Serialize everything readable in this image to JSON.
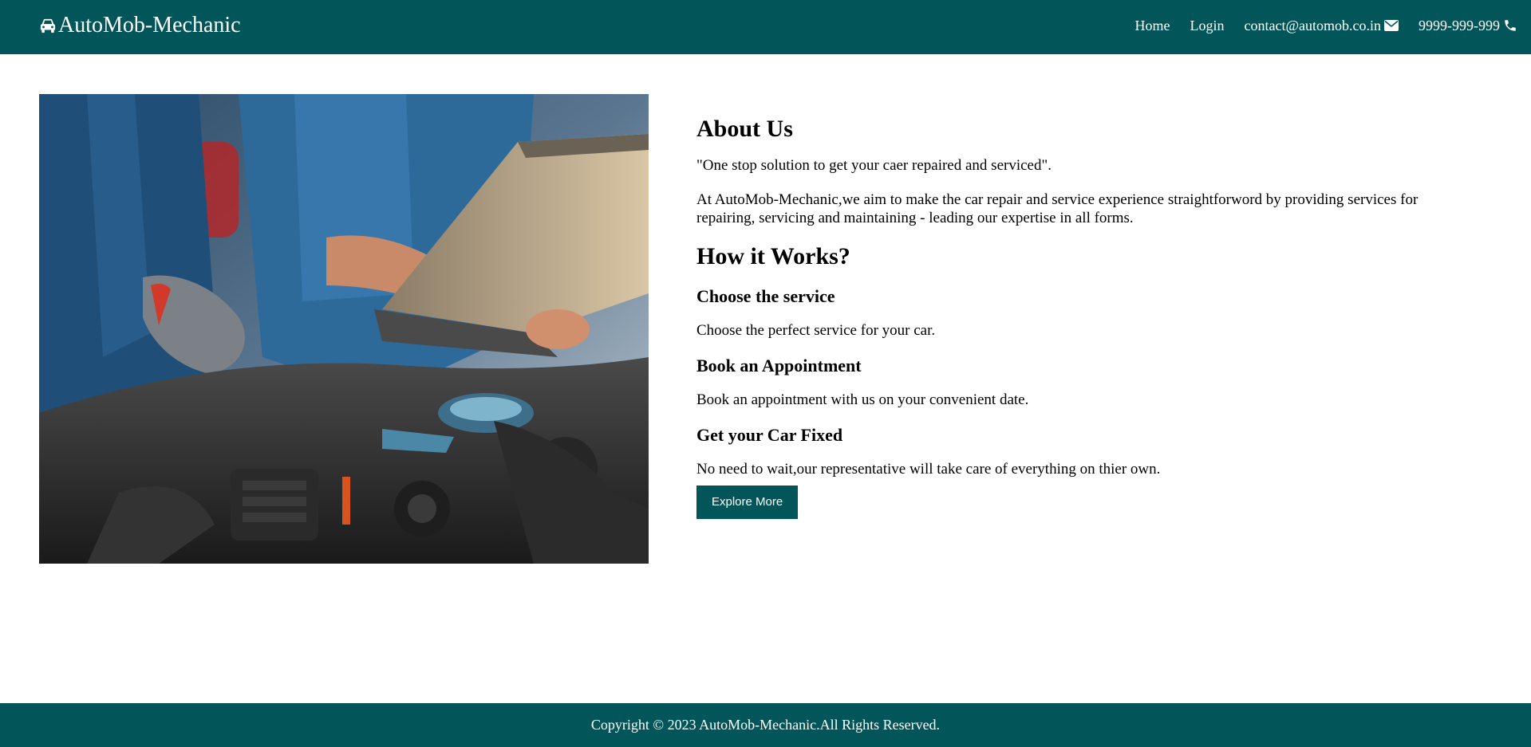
{
  "navbar": {
    "brand": "AutoMob-Mechanic",
    "brand_icon": "car-icon",
    "links": [
      {
        "label": "Home"
      },
      {
        "label": "Login"
      },
      {
        "label": "contact@automob.co.in",
        "icon": "envelope-icon"
      },
      {
        "label": "9999-999-999",
        "icon": "phone-icon"
      }
    ]
  },
  "hero": {
    "image_semantic": "mechanic-with-laptop-over-car-engine"
  },
  "about": {
    "title": "About Us",
    "tagline": "\"One stop solution to get your caer repaired and serviced\".",
    "description": "At AutoMob-Mechanic,we aim to make the car repair and service experience straightforword by providing services for repairing, servicing and maintaining - leading our expertise in all forms."
  },
  "how_it_works": {
    "title": "How it Works?",
    "steps": [
      {
        "title": "Choose the service",
        "text": "Choose the perfect service for your car."
      },
      {
        "title": "Book an Appointment",
        "text": "Book an appointment with us on your convenient date."
      },
      {
        "title": "Get your Car Fixed",
        "text": "No need to wait,our representative will take care of everything on thier own."
      }
    ]
  },
  "cta": {
    "label": "Explore More"
  },
  "footer": {
    "copyright": "Copyright © 2023 AutoMob-Mechanic.All Rights Reserved."
  },
  "colors": {
    "brand": "#025558",
    "text": "#000000",
    "background": "#ffffff"
  }
}
